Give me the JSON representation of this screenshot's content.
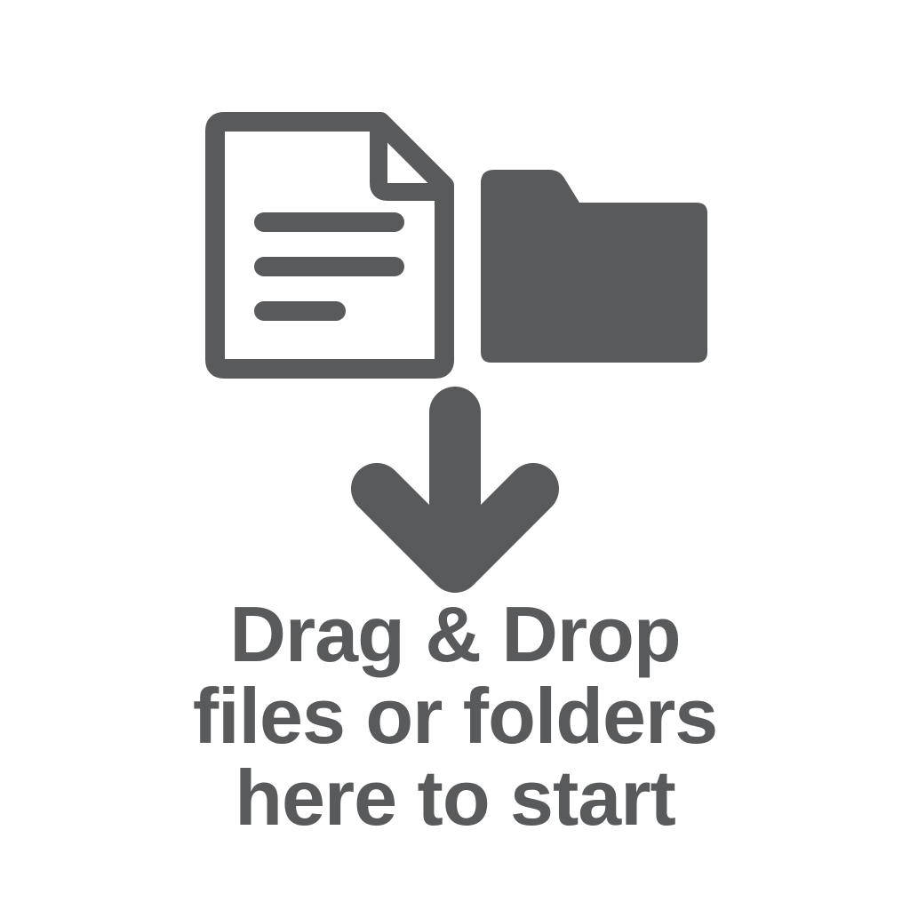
{
  "drop_zone": {
    "icons": {
      "file": "file-text-icon",
      "folder": "folder-icon",
      "arrow": "arrow-down-icon"
    },
    "lines": [
      "Drag & Drop",
      "files or folders",
      "here to start"
    ]
  },
  "colors": {
    "icon": "#595a5b",
    "background": "#ffffff"
  }
}
